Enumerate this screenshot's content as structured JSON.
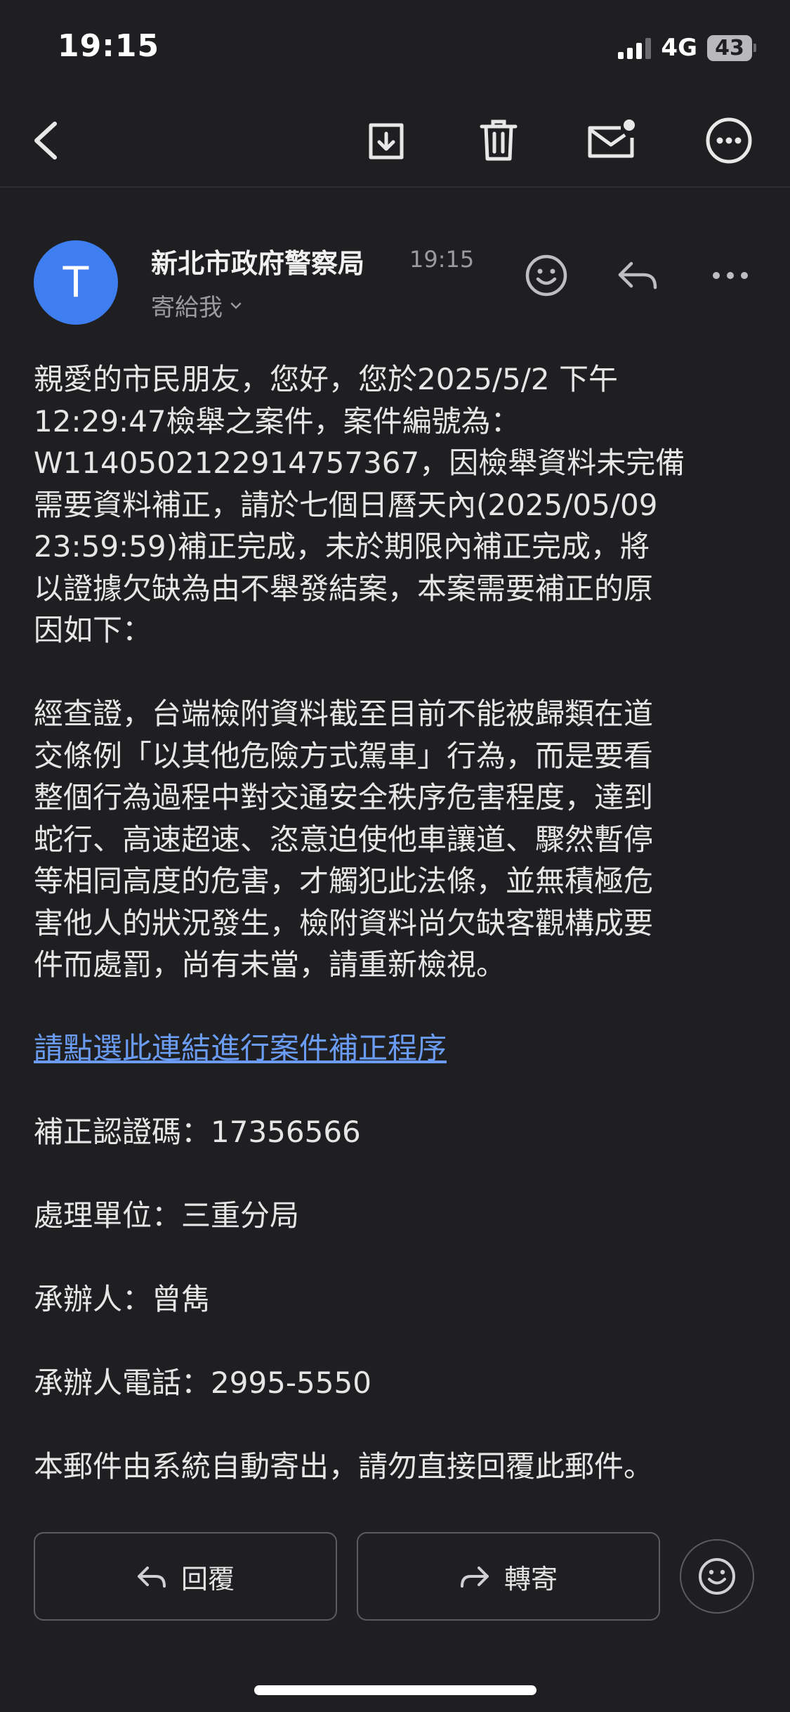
{
  "status_bar": {
    "time": "19:15",
    "network": "4G",
    "battery": "43"
  },
  "toolbar": {
    "back_icon": "back-arrow-icon",
    "archive_icon": "archive-icon",
    "delete_icon": "trash-icon",
    "unread_icon": "mark-unread-icon",
    "more_icon": "more-options-icon"
  },
  "sender": {
    "avatar_letter": "T",
    "name": "新北市政府警察局",
    "time": "19:15",
    "recipient": "寄給我"
  },
  "body": {
    "para1": [
      "親愛的市民朋友，您好，您於2025/5/2 下午",
      "12:29:47檢舉之案件，案件編號為：",
      "W11405021229147573​67，因檢舉資料未完備",
      "需要資料補正，請於七個日曆天內(2025/05/09",
      "23:59:59)補正完成，未於期限內補正完成，將",
      "以證據欠缺為由不舉發結案，本案需要補正的原",
      "因如下："
    ],
    "para2": [
      "經查證，台端檢附資料截至目前不能被歸類在道",
      "交條例「以其他危險方式駕車」行為，而是要看",
      "整個行為過程中對交通安全秩序危害程度，達到",
      "蛇行、高速超速、恣意迫使他車讓道、驟然暫停",
      "等相同高度的危害，才觸犯此法條，並無積極危",
      "害他人的狀況發生，檢附資料尚欠缺客觀構成要",
      "件而處罰，尚有未當，請重新檢視。"
    ],
    "link": "請點選此連結進行案件補正程序",
    "verify_code": "補正認證碼：17356566",
    "unit": "處理單位：三重分局",
    "officer": "承辦人：曾雋",
    "phone": "承辦人電話：2995-5550",
    "footer": "本郵件由系統自動寄出，請勿直接回覆此郵件。"
  },
  "actions": {
    "reply": "回覆",
    "forward": "轉寄"
  }
}
